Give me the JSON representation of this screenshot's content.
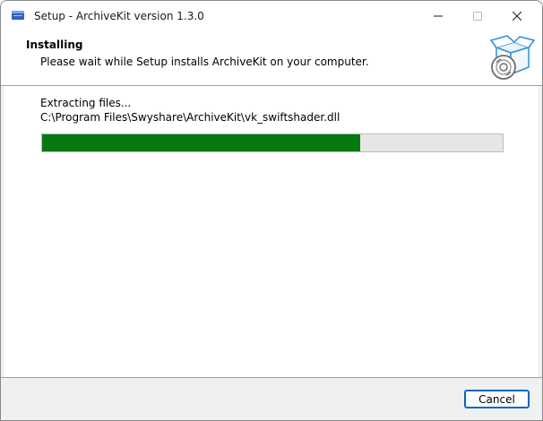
{
  "window": {
    "title": "Setup - ArchiveKit version 1.3.0"
  },
  "titlebar_buttons": {
    "minimize_icon": "minimize-icon",
    "maximize_icon": "maximize-icon",
    "close_icon": "close-icon"
  },
  "header": {
    "title": "Installing",
    "subtitle": "Please wait while Setup installs ArchiveKit on your computer.",
    "icon": "software-box-disc-icon"
  },
  "main": {
    "status": "Extracting files...",
    "current_file": "C:\\Program Files\\Swyshare\\ArchiveKit\\vk_swiftshader.dll",
    "progress": 0.69
  },
  "footer": {
    "cancel_label": "Cancel"
  },
  "colors": {
    "progress_fill": "#06780f",
    "accent": "#0067c0"
  }
}
